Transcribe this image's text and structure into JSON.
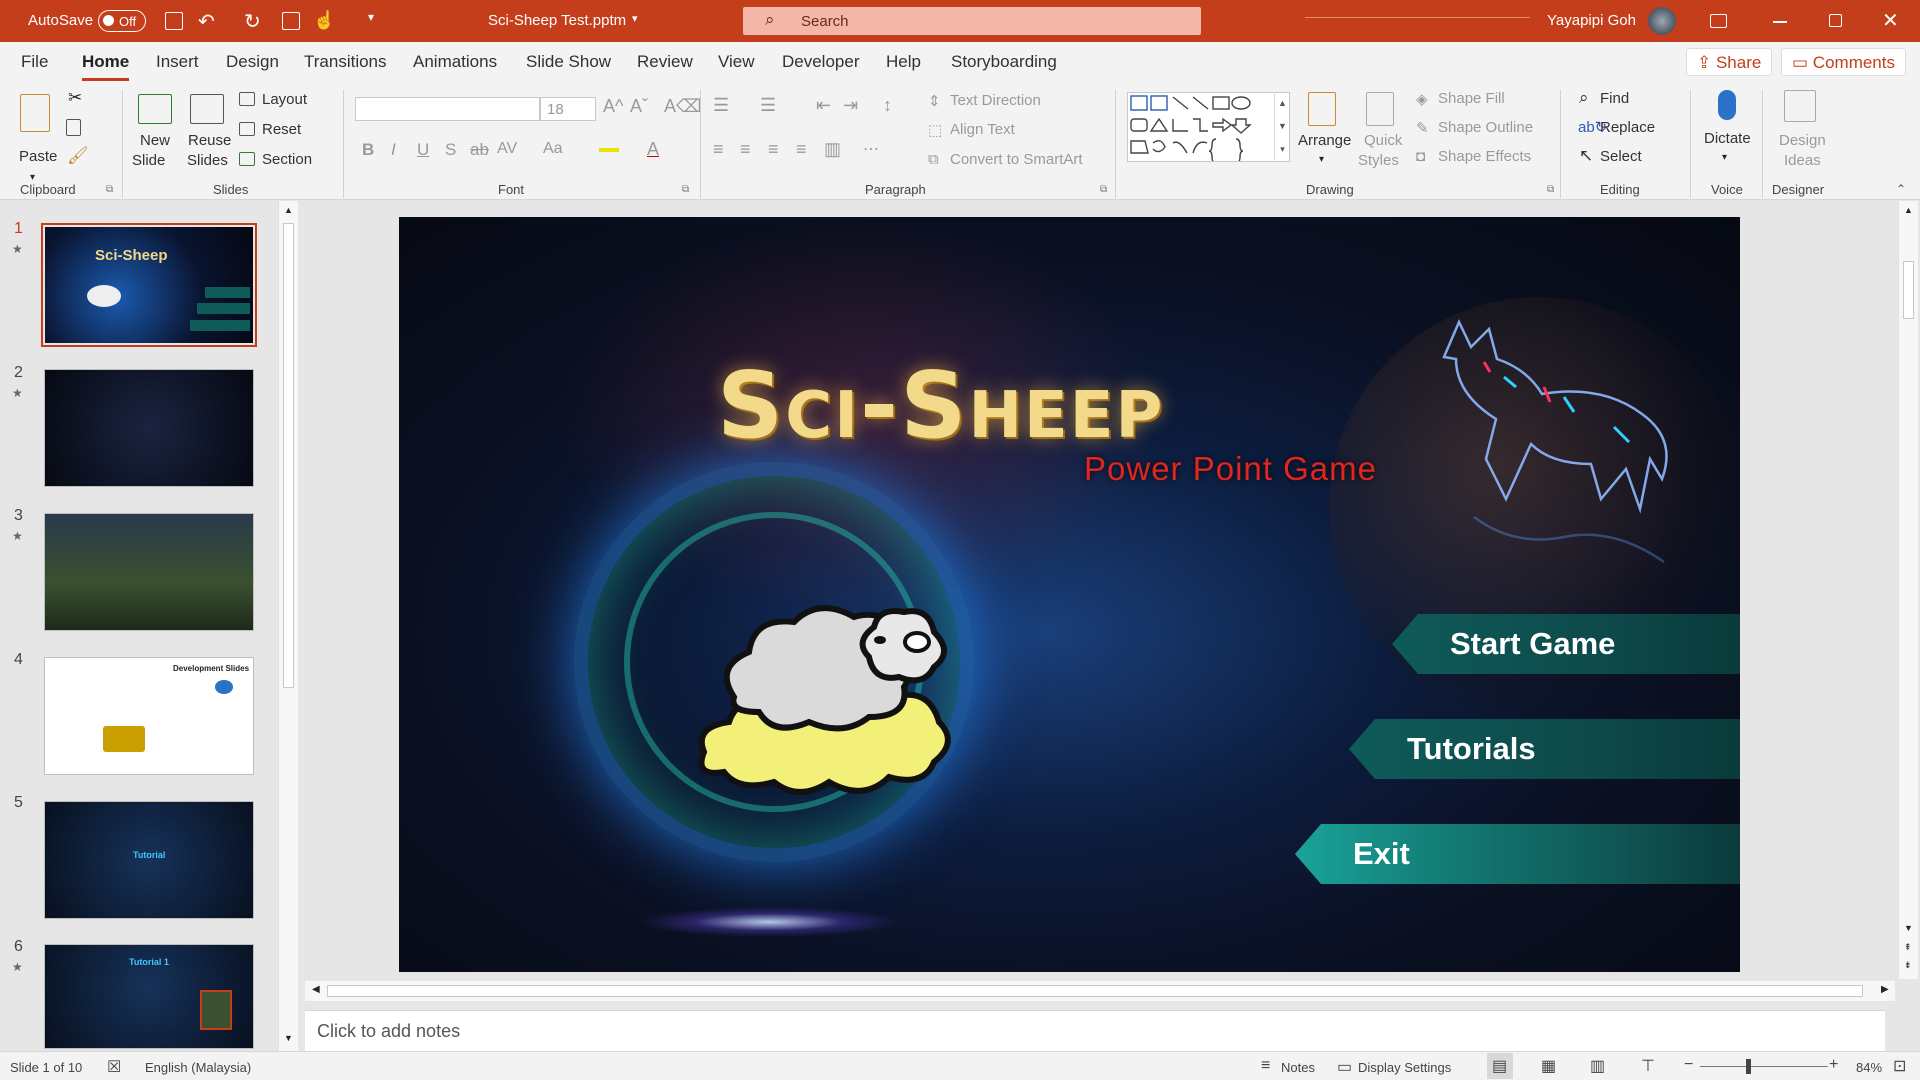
{
  "titlebar": {
    "autosave_label": "AutoSave",
    "autosave_state": "Off",
    "doc_title": "Sci-Sheep Test.pptm",
    "search_placeholder": "Search",
    "user_name": "Yayapipi Goh"
  },
  "tabs": [
    "File",
    "Home",
    "Insert",
    "Design",
    "Transitions",
    "Animations",
    "Slide Show",
    "Review",
    "View",
    "Developer",
    "Help",
    "Storyboarding"
  ],
  "active_tab": "Home",
  "share_label": "Share",
  "comments_label": "Comments",
  "ribbon": {
    "clipboard": {
      "paste": "Paste",
      "group": "Clipboard"
    },
    "slides": {
      "new_slide_1": "New",
      "new_slide_2": "Slide",
      "reuse_1": "Reuse",
      "reuse_2": "Slides",
      "layout": "Layout",
      "reset": "Reset",
      "section": "Section",
      "group": "Slides"
    },
    "font": {
      "size": "18",
      "group": "Font"
    },
    "paragraph": {
      "text_direction": "Text Direction",
      "align_text": "Align Text",
      "convert_smartart": "Convert to SmartArt",
      "group": "Paragraph"
    },
    "drawing": {
      "arrange": "Arrange",
      "quick_1": "Quick",
      "quick_2": "Styles",
      "shape_fill": "Shape Fill",
      "shape_outline": "Shape Outline",
      "shape_effects": "Shape Effects",
      "group": "Drawing"
    },
    "editing": {
      "find": "Find",
      "replace": "Replace",
      "select": "Select",
      "group": "Editing"
    },
    "voice": {
      "dictate": "Dictate",
      "group": "Voice"
    },
    "designer": {
      "ideas_1": "Design",
      "ideas_2": "Ideas",
      "group": "Designer"
    }
  },
  "thumbnails": [
    {
      "num": "1",
      "star": true,
      "title": "Sci-Sheep"
    },
    {
      "num": "2",
      "star": true
    },
    {
      "num": "3",
      "star": true
    },
    {
      "num": "4",
      "star": false,
      "title": "Development Slides"
    },
    {
      "num": "5",
      "star": false,
      "title": "Tutorial"
    },
    {
      "num": "6",
      "star": true,
      "title": "Tutorial 1"
    }
  ],
  "slide": {
    "title": "Sci-Sheep",
    "subtitle": "Power Point Game",
    "buttons": [
      "Start Game",
      "Tutorials",
      "Exit"
    ]
  },
  "notes_placeholder": "Click to add notes",
  "status": {
    "slide_info": "Slide 1 of 10",
    "language": "English (Malaysia)",
    "notes": "Notes",
    "display_settings": "Display Settings",
    "zoom": "84%"
  },
  "colors": {
    "accent": "#c43e1c",
    "ribbon_bg": "#f3f3f3",
    "button_teal": "#0f5b5a",
    "title_gold": "#f3d98a",
    "subtitle_red": "#e0261e"
  }
}
